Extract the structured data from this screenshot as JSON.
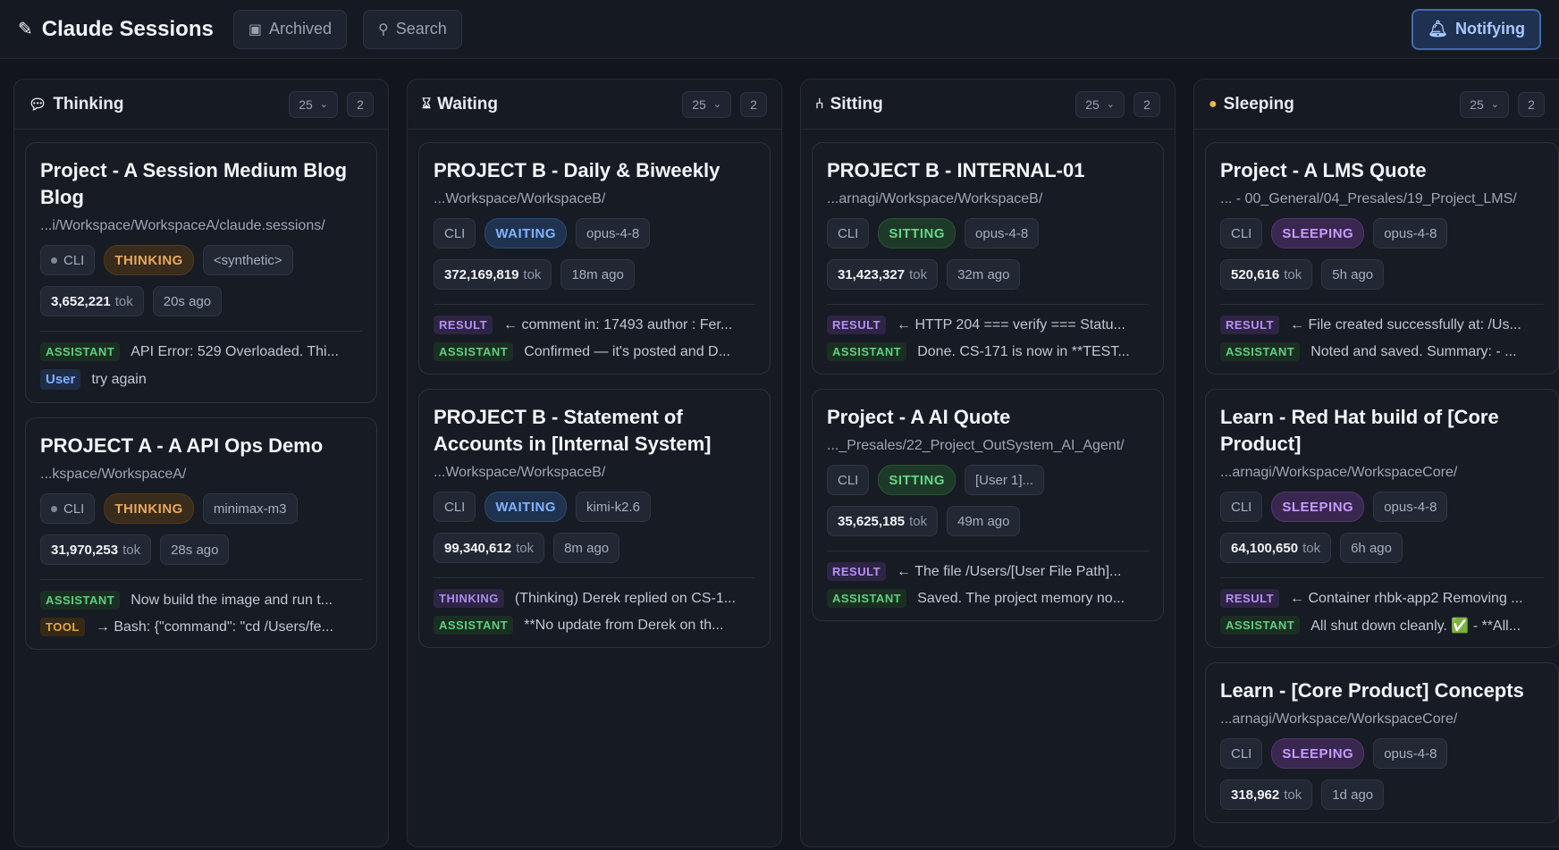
{
  "header": {
    "title": "Claude Sessions",
    "archived_label": "Archived",
    "search_label": "Search",
    "notify_label": "Notifying"
  },
  "columns": [
    {
      "name": "Thinking",
      "limit": "25",
      "count": "2",
      "cards": [
        {
          "title": "Project - A Session Medium Blog Blog",
          "path": "...i/Workspace/WorkspaceA/claude.sessions/",
          "source": "CLI",
          "status": "THINKING",
          "model": "<synthetic>",
          "tokens": "3,652,221",
          "tok_unit": "tok",
          "age": "20s ago",
          "messages": [
            {
              "tag": "ASSISTANT",
              "text": "API Error: 529 Overloaded. Thi..."
            },
            {
              "tag": "User",
              "text": "try again"
            }
          ]
        },
        {
          "title": "PROJECT A - A API Ops Demo",
          "path": "...kspace/WorkspaceA/",
          "source": "CLI",
          "status": "THINKING",
          "model": "minimax-m3",
          "tokens": "31,970,253",
          "tok_unit": "tok",
          "age": "28s ago",
          "messages": [
            {
              "tag": "ASSISTANT",
              "text": "Now build the image and run t..."
            },
            {
              "tag": "TOOL",
              "text": "→ Bash: {\"command\": \"cd /Users/fe..."
            }
          ]
        }
      ]
    },
    {
      "name": "Waiting",
      "limit": "25",
      "count": "2",
      "cards": [
        {
          "title": "PROJECT B - Daily & Biweekly",
          "path": "...Workspace/WorkspaceB/",
          "source": "CLI",
          "status": "WAITING",
          "model": "opus-4-8",
          "tokens": "372,169,819",
          "tok_unit": "tok",
          "age": "18m ago",
          "messages": [
            {
              "tag": "RESULT",
              "text": "← comment in: 17493 author : Fer..."
            },
            {
              "tag": "ASSISTANT",
              "text": "Confirmed — it's posted and D..."
            }
          ]
        },
        {
          "title": "PROJECT B - Statement of Accounts in [Internal System]",
          "path": "...Workspace/WorkspaceB/",
          "source": "CLI",
          "status": "WAITING",
          "model": "kimi-k2.6",
          "tokens": "99,340,612",
          "tok_unit": "tok",
          "age": "8m ago",
          "messages": [
            {
              "tag": "THINKING",
              "text": "(Thinking) Derek replied on CS-1..."
            },
            {
              "tag": "ASSISTANT",
              "text": "**No update from Derek on th..."
            }
          ]
        }
      ]
    },
    {
      "name": "Sitting",
      "limit": "25",
      "count": "2",
      "cards": [
        {
          "title": "PROJECT B - INTERNAL-01",
          "path": "...arnagi/Workspace/WorkspaceB/",
          "source": "CLI",
          "status": "SITTING",
          "model": "opus-4-8",
          "tokens": "31,423,327",
          "tok_unit": "tok",
          "age": "32m ago",
          "messages": [
            {
              "tag": "RESULT",
              "text": "← HTTP 204 === verify === Statu..."
            },
            {
              "tag": "ASSISTANT",
              "text": "Done. CS-171 is now in **TEST..."
            }
          ]
        },
        {
          "title": "Project - A AI Quote",
          "path": "..._Presales/22_Project_OutSystem_AI_Agent/",
          "source": "CLI",
          "status": "SITTING",
          "model": "[User 1]...",
          "tokens": "35,625,185",
          "tok_unit": "tok",
          "age": "49m ago",
          "messages": [
            {
              "tag": "RESULT",
              "text": "← The file /Users/[User File Path]..."
            },
            {
              "tag": "ASSISTANT",
              "text": "Saved. The project memory no..."
            }
          ]
        }
      ]
    },
    {
      "name": "Sleeping",
      "limit": "25",
      "count": "2",
      "cards": [
        {
          "title": "Project - A LMS Quote",
          "path": "... - 00_General/04_Presales/19_Project_LMS/",
          "source": "CLI",
          "status": "SLEEPING",
          "model": "opus-4-8",
          "tokens": "520,616",
          "tok_unit": "tok",
          "age": "5h ago",
          "messages": [
            {
              "tag": "RESULT",
              "text": "← File created successfully at: /Us..."
            },
            {
              "tag": "ASSISTANT",
              "text": "Noted and saved. Summary: - ..."
            }
          ]
        },
        {
          "title": "Learn - Red Hat build of [Core Product]",
          "path": "...arnagi/Workspace/WorkspaceCore/",
          "source": "CLI",
          "status": "SLEEPING",
          "model": "opus-4-8",
          "tokens": "64,100,650",
          "tok_unit": "tok",
          "age": "6h ago",
          "messages": [
            {
              "tag": "RESULT",
              "text": "← Container rhbk-app2 Removing ..."
            },
            {
              "tag": "ASSISTANT",
              "text": "All shut down cleanly. ✅ - **All..."
            }
          ]
        },
        {
          "title": "Learn - [Core Product] Concepts",
          "path": "...arnagi/Workspace/WorkspaceCore/",
          "source": "CLI",
          "status": "SLEEPING",
          "model": "opus-4-8",
          "tokens": "318,962",
          "tok_unit": "tok",
          "age": "1d ago",
          "messages": []
        }
      ]
    }
  ]
}
